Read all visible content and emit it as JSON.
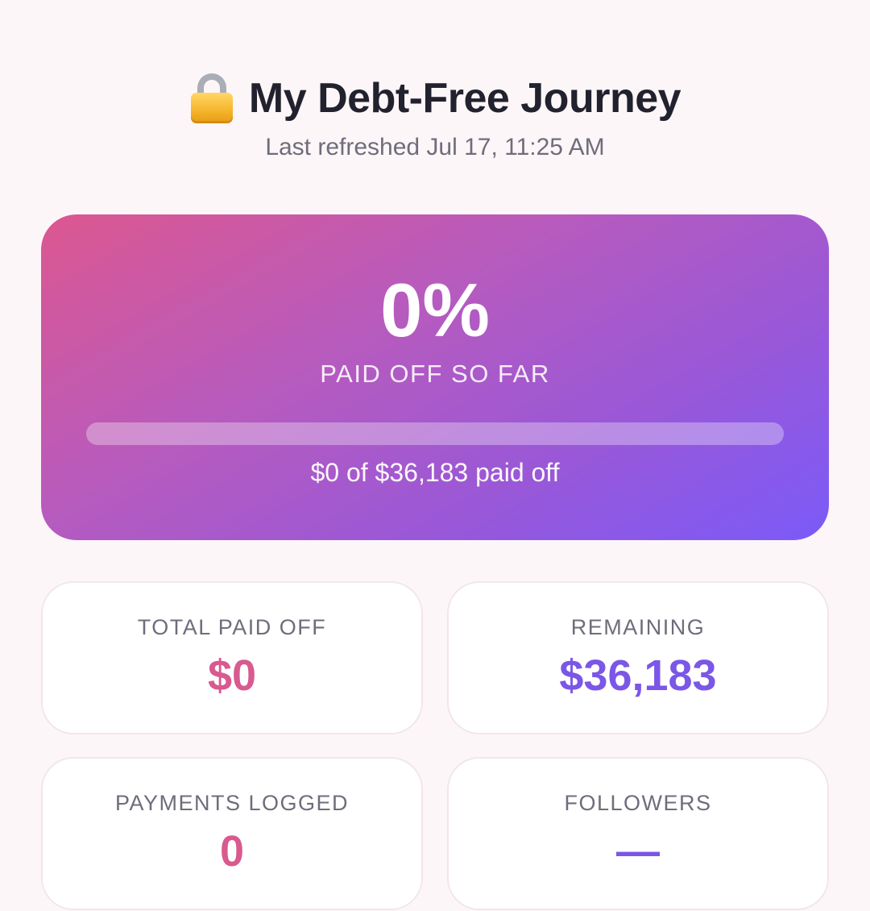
{
  "header": {
    "icon": "lock-icon",
    "title": "My Debt-Free Journey",
    "subtitle": "Last refreshed Jul 17, 11:25 AM"
  },
  "hero": {
    "percent_text": "0%",
    "label": "PAID OFF SO FAR",
    "progress_fraction": 0,
    "amount_text": "$0 of $36,183 paid off",
    "gradient_colors": [
      "#dc5790",
      "#7b5af8"
    ]
  },
  "stats": [
    {
      "label": "TOTAL PAID OFF",
      "value": "$0",
      "color": "#d85a8f"
    },
    {
      "label": "REMAINING",
      "value": "$36,183",
      "color": "#7a57e6"
    },
    {
      "label": "PAYMENTS LOGGED",
      "value": "0",
      "color": "#d85a8f"
    },
    {
      "label": "FOLLOWERS",
      "value": "—",
      "color": "#7a57e6"
    }
  ]
}
